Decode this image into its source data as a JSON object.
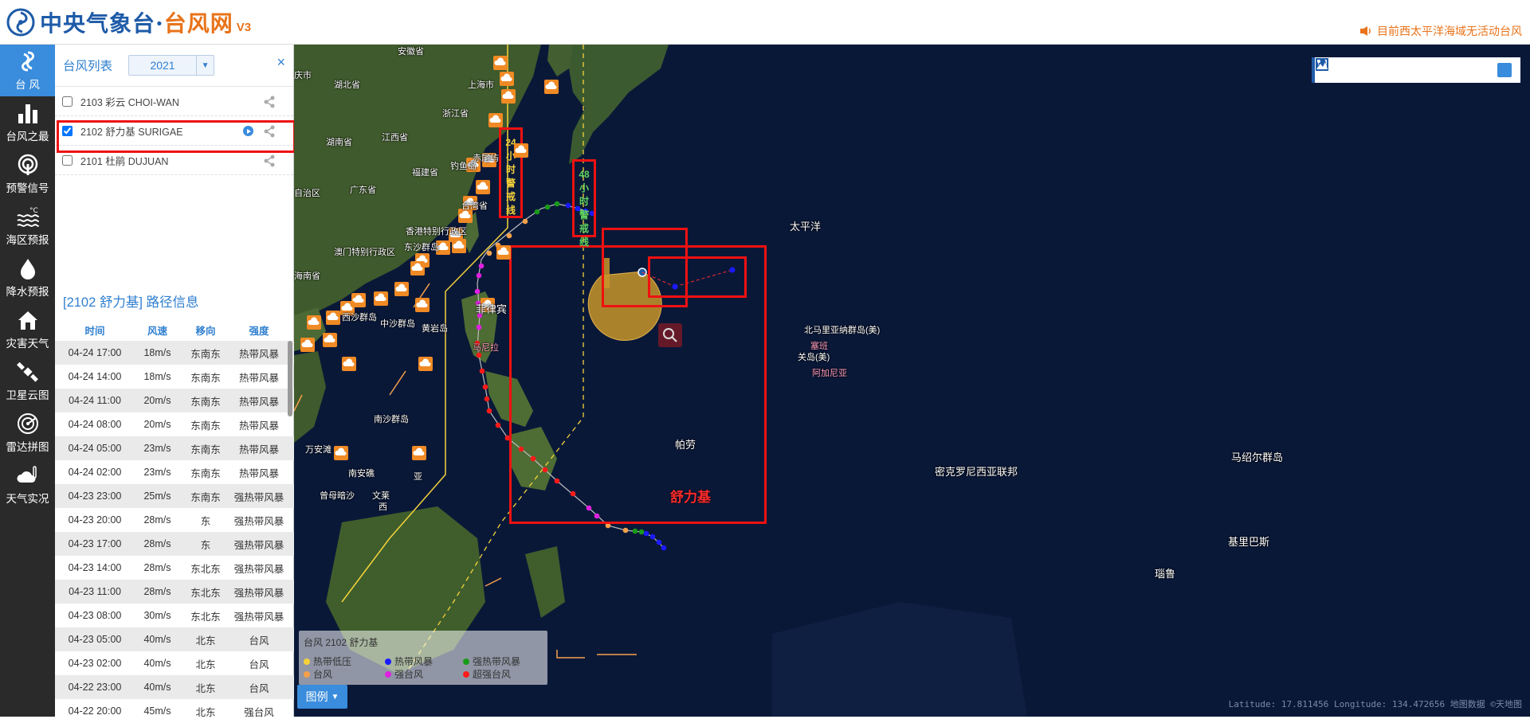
{
  "header": {
    "logo_main": "中央气象台·",
    "logo_accent": "台风网",
    "logo_version": "V3",
    "notice": "目前西太平洋海域无活动台风"
  },
  "nav": {
    "items": [
      {
        "label": "台 风",
        "icon": "typhoon-icon"
      },
      {
        "label": "台风之最",
        "icon": "bar-chart-icon"
      },
      {
        "label": "预警信号",
        "icon": "signal-icon"
      },
      {
        "label": "海区预报",
        "icon": "sea-forecast-icon"
      },
      {
        "label": "降水预报",
        "icon": "raindrop-icon"
      },
      {
        "label": "灾害天气",
        "icon": "house-icon"
      },
      {
        "label": "卫星云图",
        "icon": "satellite-icon"
      },
      {
        "label": "雷达拼图",
        "icon": "radar-icon"
      },
      {
        "label": "天气实况",
        "icon": "cloud-thermo-icon"
      }
    ]
  },
  "typhoon_list": {
    "title": "台风列表",
    "year": "2021",
    "items": [
      {
        "label": "2103 彩云 CHOI-WAN",
        "checked": false
      },
      {
        "label": "2102 舒力基 SURIGAE",
        "checked": true
      },
      {
        "label": "2101 杜鹃 DUJUAN",
        "checked": false
      }
    ]
  },
  "path_info": {
    "title": "[2102 舒力基] 路径信息",
    "headers": [
      "时间",
      "风速",
      "移向",
      "强度"
    ],
    "rows": [
      [
        "04-24 17:00",
        "18m/s",
        "东南东",
        "热带风暴"
      ],
      [
        "04-24 14:00",
        "18m/s",
        "东南东",
        "热带风暴"
      ],
      [
        "04-24 11:00",
        "20m/s",
        "东南东",
        "热带风暴"
      ],
      [
        "04-24 08:00",
        "20m/s",
        "东南东",
        "热带风暴"
      ],
      [
        "04-24 05:00",
        "23m/s",
        "东南东",
        "热带风暴"
      ],
      [
        "04-24 02:00",
        "23m/s",
        "东南东",
        "热带风暴"
      ],
      [
        "04-23 23:00",
        "25m/s",
        "东南东",
        "强热带风暴"
      ],
      [
        "04-23 20:00",
        "28m/s",
        "东",
        "强热带风暴"
      ],
      [
        "04-23 17:00",
        "28m/s",
        "东",
        "强热带风暴"
      ],
      [
        "04-23 14:00",
        "28m/s",
        "东北东",
        "强热带风暴"
      ],
      [
        "04-23 11:00",
        "28m/s",
        "东北东",
        "强热带风暴"
      ],
      [
        "04-23 08:00",
        "30m/s",
        "东北东",
        "强热带风暴"
      ],
      [
        "04-23 05:00",
        "40m/s",
        "北东",
        "台风"
      ],
      [
        "04-23 02:00",
        "40m/s",
        "北东",
        "台风"
      ],
      [
        "04-22 23:00",
        "40m/s",
        "北东",
        "台风"
      ],
      [
        "04-22 20:00",
        "45m/s",
        "北东",
        "强台风"
      ]
    ]
  },
  "map": {
    "warning_24": "24小时警戒线",
    "warning_48": "48小时警戒线",
    "typhoon_name": "舒力基",
    "labels": [
      {
        "text": "安徽省"
      },
      {
        "text": "湖北省"
      },
      {
        "text": "上海市"
      },
      {
        "text": "浙江省"
      },
      {
        "text": "湖南省"
      },
      {
        "text": "江西省"
      },
      {
        "text": "福建省"
      },
      {
        "text": "广东省"
      },
      {
        "text": "台湾省"
      },
      {
        "text": "香港特别行政区"
      },
      {
        "text": "澳门特别行政区"
      },
      {
        "text": "海南省"
      },
      {
        "text": "赤尾屿"
      },
      {
        "text": "钓鱼岛"
      },
      {
        "text": "东沙群岛"
      },
      {
        "text": "西沙群岛"
      },
      {
        "text": "中沙群岛"
      },
      {
        "text": "黄岩岛"
      },
      {
        "text": "菲律宾"
      },
      {
        "text": "马尼拉"
      },
      {
        "text": "南沙群岛"
      },
      {
        "text": "万安滩"
      },
      {
        "text": "南安礁"
      },
      {
        "text": "曾母暗沙"
      },
      {
        "text": "文莱"
      },
      {
        "text": "帕劳"
      },
      {
        "text": "太平洋"
      },
      {
        "text": "北马里亚纳群岛(美)"
      },
      {
        "text": "塞班"
      },
      {
        "text": "关岛(美)"
      },
      {
        "text": "阿加尼亚"
      },
      {
        "text": "密克罗尼西亚联邦"
      },
      {
        "text": "马绍尔群岛"
      },
      {
        "text": "基里巴斯"
      },
      {
        "text": "瑙鲁"
      },
      {
        "text": "自治区"
      },
      {
        "text": "庆市"
      },
      {
        "text": "亚"
      },
      {
        "text": "西"
      }
    ],
    "legend": {
      "title": "台风  2102 舒力基",
      "items": [
        {
          "label": "热带低压",
          "color": "#f5d23a"
        },
        {
          "label": "热带风暴",
          "color": "#1a1aff"
        },
        {
          "label": "强热带风暴",
          "color": "#1a9a1a"
        },
        {
          "label": "台风",
          "color": "#f5a04a"
        },
        {
          "label": "强台风",
          "color": "#e020e0"
        },
        {
          "label": "超强台风",
          "color": "#ff1a1a"
        }
      ],
      "button": "图例"
    },
    "coords": "Latitude: 17.811456 Longitude: 134.472656  地图数据 ©天地图"
  }
}
